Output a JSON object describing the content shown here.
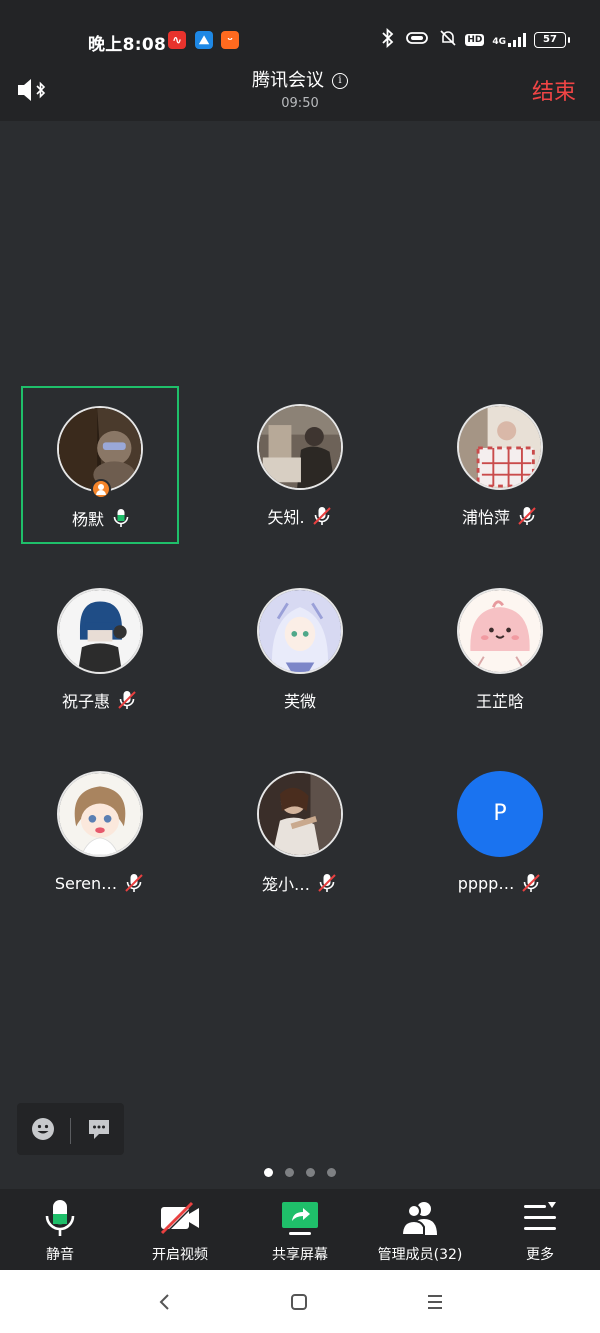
{
  "status_bar": {
    "time": "晚上8:08",
    "app_icons": [
      {
        "name": "news-app-icon",
        "color": "#e8332d",
        "glyph": "∿"
      },
      {
        "name": "mountain-app-icon",
        "color": "#1e88e5",
        "glyph": "⛰"
      },
      {
        "name": "taobao-app-icon",
        "color": "#ff6a1f",
        "glyph": "ᵕ"
      }
    ],
    "hd_label": "HD",
    "network_label": "4G",
    "battery": "57"
  },
  "header": {
    "title": "腾讯会议",
    "timer": "09:50",
    "end_label": "结束"
  },
  "participants": [
    {
      "name": "杨默",
      "mic": "on",
      "host": true,
      "active": true,
      "avatar": "photo-dark"
    },
    {
      "name": "矢矧.",
      "mic": "muted",
      "avatar": "photo-room"
    },
    {
      "name": "浦怡萍",
      "mic": "muted",
      "avatar": "photo-bed"
    },
    {
      "name": "祝子惠",
      "mic": "muted",
      "avatar": "cartoon-hood"
    },
    {
      "name": "芙微",
      "mic": "none",
      "avatar": "anime-girl"
    },
    {
      "name": "王芷晗",
      "mic": "none",
      "avatar": "pink-blob"
    },
    {
      "name": "Seren…",
      "mic": "muted",
      "avatar": "cartoon-girl"
    },
    {
      "name": "笼小…",
      "mic": "muted",
      "avatar": "photo-hug"
    },
    {
      "name": "pppp…",
      "mic": "muted",
      "avatar": "letter",
      "initial": "P"
    }
  ],
  "reactions": {
    "emoji_icon": "smiley-icon",
    "chat_icon": "chat-bubble-icon"
  },
  "pager": {
    "pages": 4,
    "current": 1
  },
  "toolbar": [
    {
      "label": "静音",
      "icon": "microphone-icon"
    },
    {
      "label": "开启视频",
      "icon": "video-off-icon"
    },
    {
      "label": "共享屏幕",
      "icon": "share-screen-icon"
    },
    {
      "label": "管理成员(32)",
      "icon": "members-icon"
    },
    {
      "label": "更多",
      "icon": "more-menu-icon"
    }
  ],
  "colors": {
    "background": "#2b2d30",
    "bar": "#232426",
    "active_border": "#1fbf6a",
    "end_red": "#f04545",
    "mic_on_green": "#1fbf6a",
    "muted_red": "#e94040",
    "letter_avatar": "#1a73f0",
    "host_badge": "#f4842a"
  }
}
